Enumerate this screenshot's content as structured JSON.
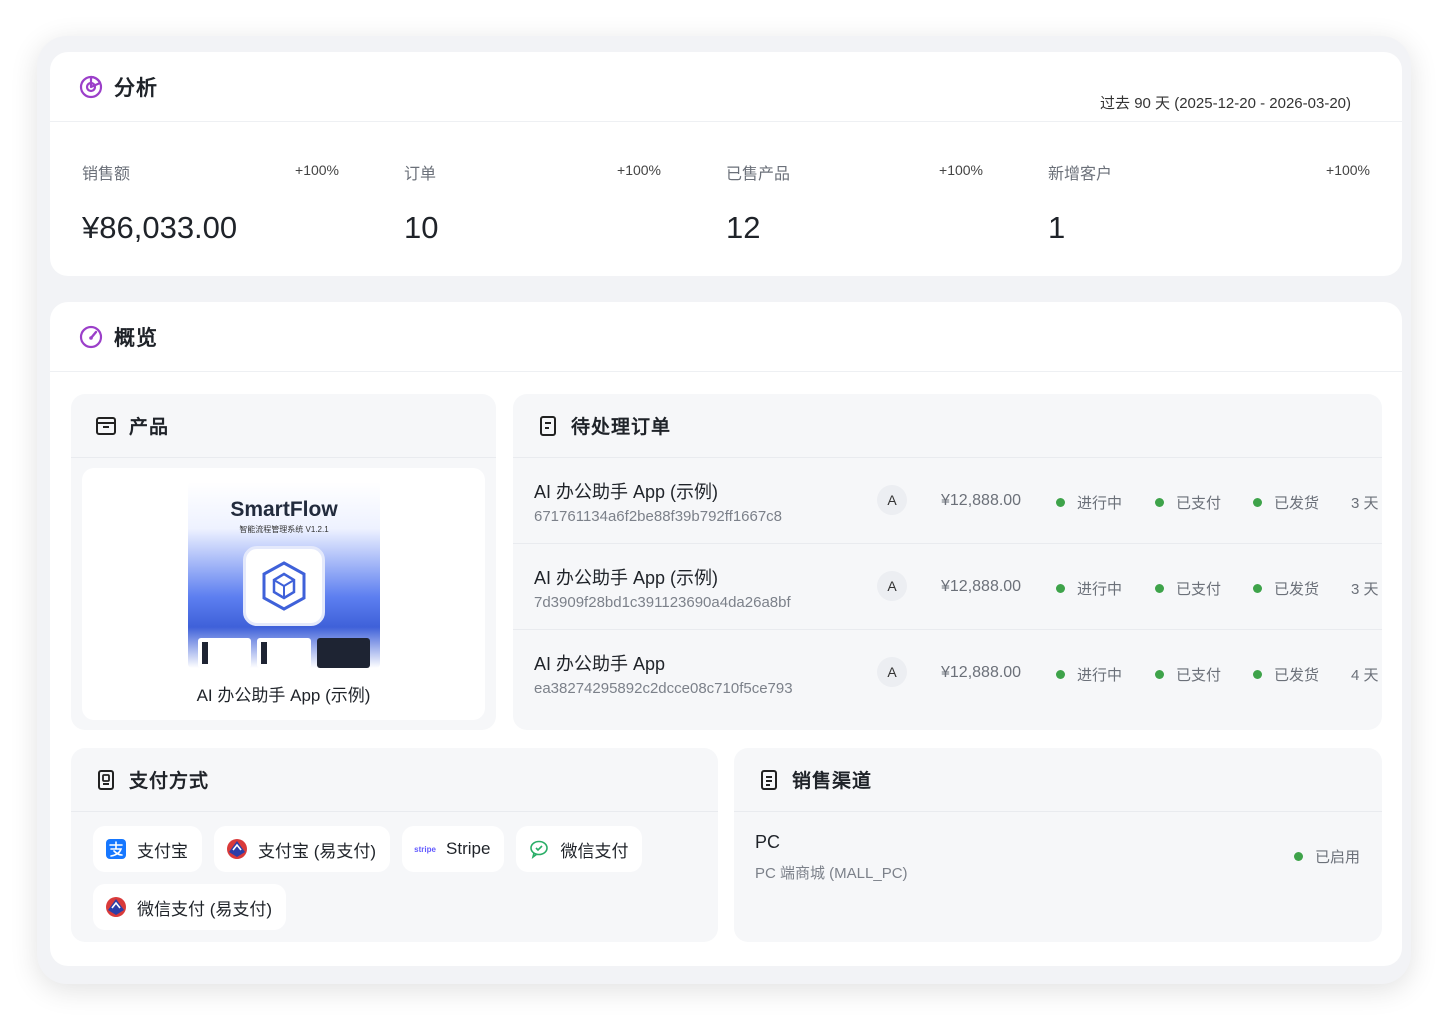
{
  "analytics": {
    "title": "分析",
    "range": "过去 90 天 (2025-12-20 - 2026-03-20)",
    "metrics": [
      {
        "label": "销售额",
        "change": "+100%",
        "value": "¥86,033.00"
      },
      {
        "label": "订单",
        "change": "+100%",
        "value": "10"
      },
      {
        "label": "已售产品",
        "change": "+100%",
        "value": "12"
      },
      {
        "label": "新增客户",
        "change": "+100%",
        "value": "1"
      }
    ]
  },
  "overview": {
    "title": "概览",
    "products": {
      "title": "产品",
      "thumb_title": "SmartFlow",
      "thumb_subtitle": "智能流程管理系统 V1.2.1",
      "name": "AI 办公助手 App (示例)"
    },
    "orders": {
      "title": "待处理订单",
      "rows": [
        {
          "name": "AI 办公助手 App (示例)",
          "id": "671761134a6f2be88f39b792ff1667c8",
          "avatar": "A",
          "amount": "¥12,888.00",
          "status": "进行中",
          "payment": "已支付",
          "shipping": "已发货",
          "age": "3 天"
        },
        {
          "name": "AI 办公助手 App (示例)",
          "id": "7d3909f28bd1c391123690a4da26a8bf",
          "avatar": "A",
          "amount": "¥12,888.00",
          "status": "进行中",
          "payment": "已支付",
          "shipping": "已发货",
          "age": "3 天"
        },
        {
          "name": "AI 办公助手 App",
          "id": "ea38274295892c2dcce08c710f5ce793",
          "avatar": "A",
          "amount": "¥12,888.00",
          "status": "进行中",
          "payment": "已支付",
          "shipping": "已发货",
          "age": "4 天"
        }
      ]
    },
    "payments": {
      "title": "支付方式",
      "methods": [
        {
          "label": "支付宝",
          "icon": "alipay-icon"
        },
        {
          "label": "支付宝 (易支付)",
          "icon": "epay-icon"
        },
        {
          "label": "Stripe",
          "icon": "stripe-icon",
          "icon_text": "stripe"
        },
        {
          "label": "微信支付",
          "icon": "wechat-icon"
        },
        {
          "label": "微信支付 (易支付)",
          "icon": "epay-icon"
        }
      ]
    },
    "channels": {
      "title": "销售渠道",
      "name": "PC",
      "code": "PC 端商城 (MALL_PC)",
      "status": "已启用"
    }
  },
  "colors": {
    "accent": "#9b3fc9",
    "status_green": "#3ea34a",
    "alipay_blue": "#1677ff",
    "wechat_green": "#2aae67"
  }
}
